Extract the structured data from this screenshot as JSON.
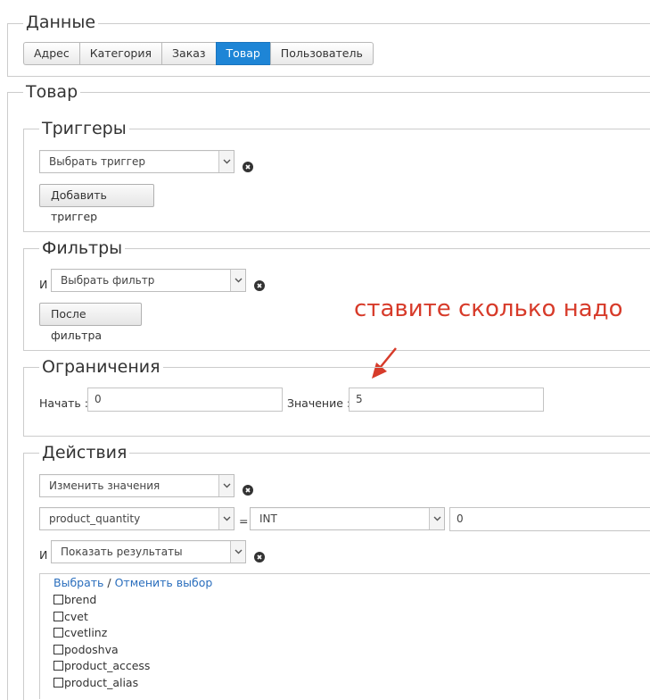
{
  "data_section": {
    "legend": "Данные",
    "tabs": [
      {
        "label": "Адрес",
        "active": false
      },
      {
        "label": "Категория",
        "active": false
      },
      {
        "label": "Заказ",
        "active": false
      },
      {
        "label": "Товар",
        "active": true
      },
      {
        "label": "Пользователь",
        "active": false
      }
    ]
  },
  "product_section": {
    "legend": "Товар",
    "triggers": {
      "legend": "Триггеры",
      "select_value": "Выбрать триггер",
      "add_button": "Добавить триггер"
    },
    "filters": {
      "legend": "Фильтры",
      "and_label": "И",
      "select_value": "Выбрать фильтр",
      "after_button": "После фильтра"
    },
    "limits": {
      "legend": "Ограничения",
      "start_label": "Начать :",
      "start_value": "0",
      "value_label": "Значение :",
      "value_value": "5"
    },
    "actions": {
      "legend": "Действия",
      "action_select": "Изменить значения",
      "field_select": "product_quantity",
      "equals": "=",
      "type_select": "INT",
      "value_input": "0",
      "and_label": "И",
      "results_select": "Показать результаты",
      "select_link": "Выбрать",
      "separator": "/",
      "deselect_link": "Отменить выбор",
      "columns": [
        "brend",
        "cvet",
        "cvetlinz",
        "podoshva",
        "product_access",
        "product_alias"
      ]
    }
  },
  "annotation": "ставите сколько надо",
  "colors": {
    "active_tab": "#1e85d6",
    "annotation": "#d73b2a",
    "link": "#2a6ebd"
  }
}
